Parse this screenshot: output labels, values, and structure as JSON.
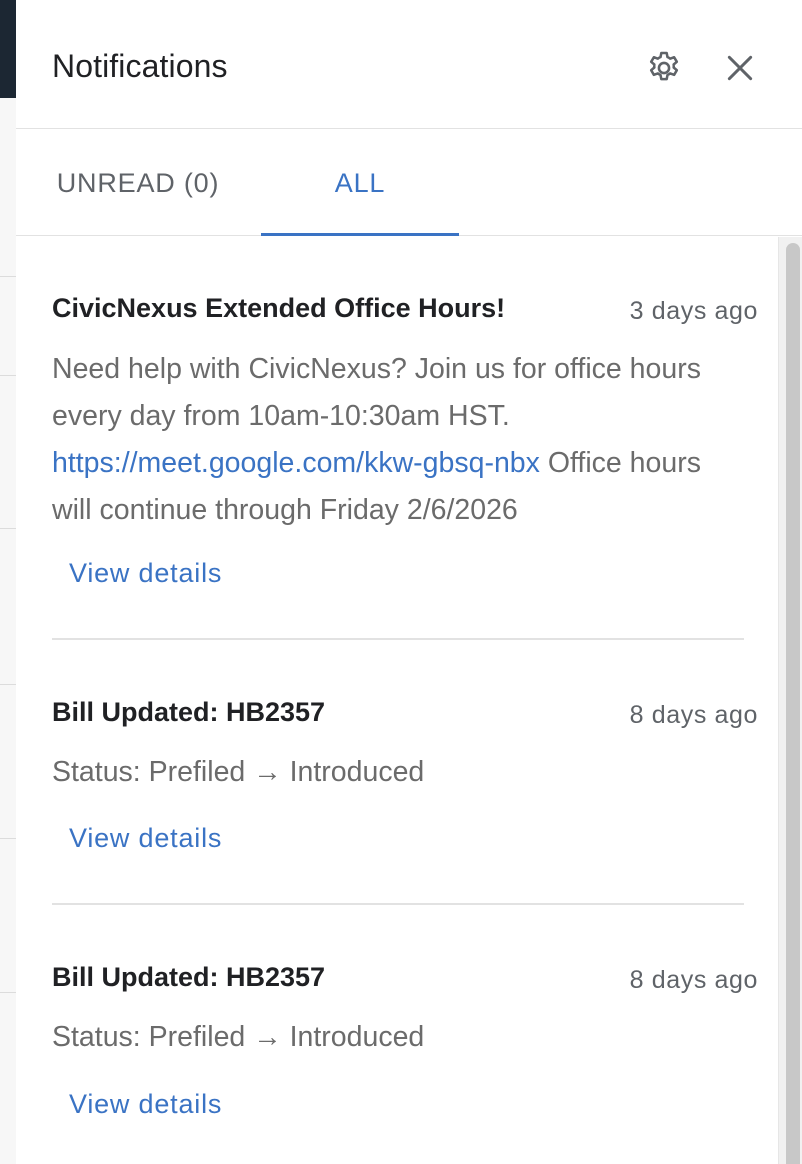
{
  "drawer": {
    "title": "Notifications",
    "settings_icon": "gear-icon",
    "close_icon": "close-icon"
  },
  "tabs": [
    {
      "label": "UNREAD (0)",
      "active": false
    },
    {
      "label": "ALL",
      "active": true
    }
  ],
  "colors": {
    "accent": "#3a73c4",
    "muted_text": "#6b6b6b"
  },
  "notifications": [
    {
      "title": "CivicNexus Extended Office Hours!",
      "time": "3 days ago",
      "body_before_link": "Need help with CivicNexus? Join us for office hours every day from 10am-10:30am HST. ",
      "link": "https://meet.google.com/kkw-gbsq-nbx",
      "body_after_link": " Office hours will continue through Friday 2/6/2026",
      "action": "View details"
    },
    {
      "title": "Bill Updated: HB2357",
      "time": "8 days ago",
      "body": "Status: Prefiled → Introduced",
      "action": "View details"
    },
    {
      "title": "Bill Updated: HB2357",
      "time": "8 days ago",
      "body": "Status: Prefiled → Introduced",
      "action": "View details"
    }
  ]
}
